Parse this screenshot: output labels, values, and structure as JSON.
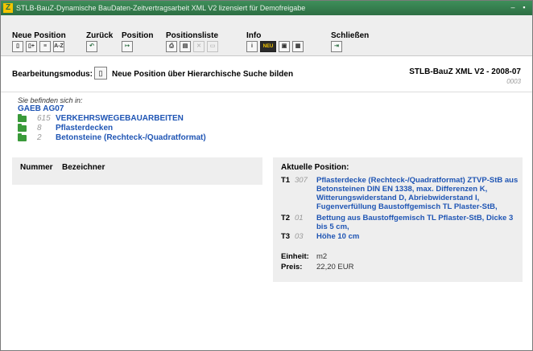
{
  "window": {
    "title": "STLB-BauZ-Dynamische BauDaten-Zeitvertragsarbeit XML V2 lizensiert für Demofreigabe",
    "app_icon_letter": "Z",
    "minimize_glyph": "–",
    "close_glyph": "▪"
  },
  "toolbar": {
    "groups": [
      {
        "label": "Neue Position",
        "buttons": [
          {
            "icon": "new-document-icon",
            "glyph": "▯"
          },
          {
            "icon": "document-add-icon",
            "glyph": "▯+"
          },
          {
            "icon": "document-list-icon",
            "glyph": "≡"
          },
          {
            "icon": "sort-az-icon",
            "glyph": "A-Z"
          }
        ]
      },
      {
        "label": "Zurück",
        "buttons": [
          {
            "icon": "undo-icon",
            "glyph": "↶"
          }
        ]
      },
      {
        "label": "Position",
        "buttons": [
          {
            "icon": "position-arrow-icon",
            "glyph": "↦"
          }
        ]
      },
      {
        "label": "Positionsliste",
        "buttons": [
          {
            "icon": "list-print-icon",
            "glyph": "⎙"
          },
          {
            "icon": "list-document-icon",
            "glyph": "▤"
          },
          {
            "icon": "delete-icon",
            "glyph": "✕",
            "disabled": true
          },
          {
            "icon": "list-disabled-icon",
            "glyph": "▭",
            "disabled": true
          }
        ]
      },
      {
        "label": "Info",
        "buttons": [
          {
            "icon": "info-icon",
            "glyph": "i"
          },
          {
            "icon": "new-badge-icon",
            "glyph": "NEU"
          },
          {
            "icon": "info-window-icon",
            "glyph": "▣"
          },
          {
            "icon": "info-print-icon",
            "glyph": "▦"
          }
        ]
      },
      {
        "label": "Schließen",
        "buttons": [
          {
            "icon": "exit-door-icon",
            "glyph": "⇥"
          }
        ]
      }
    ]
  },
  "mode": {
    "label": "Bearbeitungsmodus:",
    "button_icon": "new-document-icon",
    "button_glyph": "▯",
    "text": "Neue Position über Hierarchische Suche bilden",
    "version": "STLB-BauZ XML V2 - 2008-07",
    "version_number": "0003"
  },
  "breadcrumb": {
    "intro": "Sie befinden sich in:",
    "root": "GAEB AG07",
    "items": [
      {
        "number": "615",
        "name": "VERKEHRSWEGEBAUARBEITEN"
      },
      {
        "number": "8",
        "name": "Pflasterdecken"
      },
      {
        "number": "2",
        "name": "Betonsteine (Rechteck-/Quadratformat)"
      }
    ]
  },
  "list_panel": {
    "col_number": "Nummer",
    "col_label": "Bezeichner"
  },
  "position_panel": {
    "header": "Aktuelle Position:",
    "rows": [
      {
        "level": "T1",
        "number": "307",
        "text": "Pflasterdecke (Rechteck-/Quadratformat) ZTVP-StB aus Betonsteinen DIN EN 1338, max. Differenzen K, Witterungswiderstand D, Abriebwiderstand I, Fugenverfüllung Baustoffgemisch TL Plaster-StB,"
      },
      {
        "level": "T2",
        "number": "01",
        "text": "Bettung aus Baustoffgemisch TL Pflaster-StB, Dicke 3 bis 5 cm,"
      },
      {
        "level": "T3",
        "number": "03",
        "text": "Höhe 10 cm"
      }
    ],
    "unit_label": "Einheit:",
    "unit_value": "m2",
    "price_label": "Preis:",
    "price_value": "22,20 EUR"
  }
}
